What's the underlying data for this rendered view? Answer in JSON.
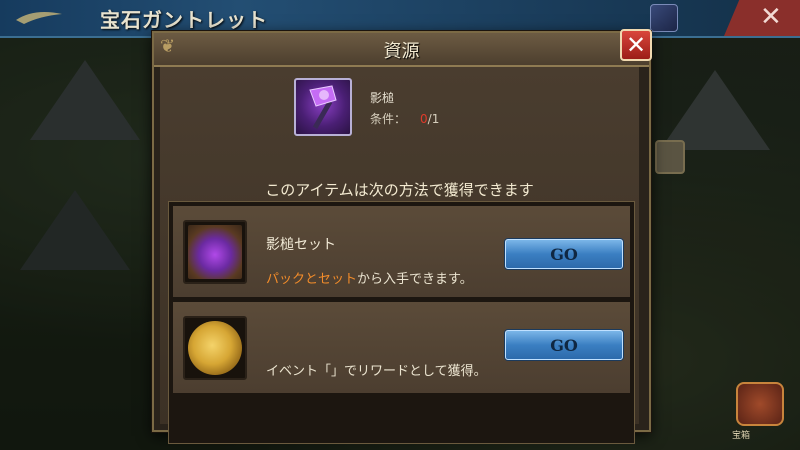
{
  "background": {
    "title": "宝石ガントレット",
    "close_icon": "✕",
    "side_button_label": "宝箱"
  },
  "dialog": {
    "title": "資源",
    "close_icon": "✕",
    "item": {
      "name": "影槌",
      "condition_label": "条件：",
      "condition_current": "0",
      "condition_separator": "/",
      "condition_required": "1"
    },
    "subtitle": "このアイテムは次の方法で獲得できます",
    "sources": [
      {
        "title": "影槌セット",
        "desc_highlight": "パックとセット",
        "desc_rest": "から入手できます。",
        "button": "GO"
      },
      {
        "title": "",
        "desc_highlight": "",
        "desc_rest": "イベント「」でリワードとして獲得。",
        "button": "GO"
      }
    ]
  },
  "colors": {
    "highlight": "#f28c2a",
    "condition_red": "#e03b2a",
    "go_button": "#3b7fc2",
    "close_red": "#c8342b"
  }
}
